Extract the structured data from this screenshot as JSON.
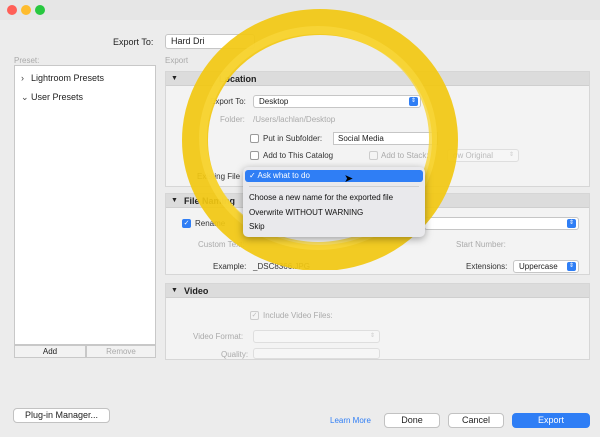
{
  "window": {
    "controls": [
      "close",
      "minimize",
      "zoom"
    ],
    "export_to_label": "Export To:",
    "export_to_value": "Hard Dri"
  },
  "colors": {
    "accent": "#2f7ef5",
    "overlay_circle": "#f2c811"
  },
  "sidebar": {
    "header": "Preset:",
    "items": [
      {
        "label": "Lightroom Presets",
        "icon": "chevron-right-icon"
      },
      {
        "label": "User Presets",
        "icon": "chevron-down-icon"
      }
    ],
    "add_label": "Add",
    "remove_label": "Remove",
    "plugin_manager_label": "Plug-in Manager..."
  },
  "main": {
    "header": "Export",
    "export_location": {
      "title": "Location",
      "export_to_label": "Export To:",
      "export_to_value": "Desktop",
      "folder_label": "Folder:",
      "folder_value": "/Users/lachlan/Desktop",
      "subfolder_label": "Put in Subfolder:",
      "subfolder_value": "Social Media",
      "catalog_label": "Add to This Catalog",
      "stack_label": "Add to Stack:",
      "stack_value": "ow Original",
      "existing_label": "Existing File"
    },
    "file_naming": {
      "title": "File Naming",
      "rename_label": "Rename",
      "custom_text_label": "Custom Text:",
      "start_number_label": "Start Number:",
      "example_label": "Example:",
      "example_value": "_DSC8366.JPG",
      "extensions_label": "Extensions:",
      "extensions_value": "Uppercase"
    },
    "video": {
      "title": "Video",
      "include_label": "Include Video Files:",
      "format_label": "Video Format:",
      "quality_label": "Quality:"
    }
  },
  "dropdown": {
    "checkmark": "✓",
    "selected": "Ask what to do",
    "options": [
      "Choose a new name for the exported file",
      "Overwrite WITHOUT WARNING",
      "Skip"
    ]
  },
  "footer": {
    "learn_more": "Learn More",
    "done": "Done",
    "cancel": "Cancel",
    "export": "Export"
  }
}
